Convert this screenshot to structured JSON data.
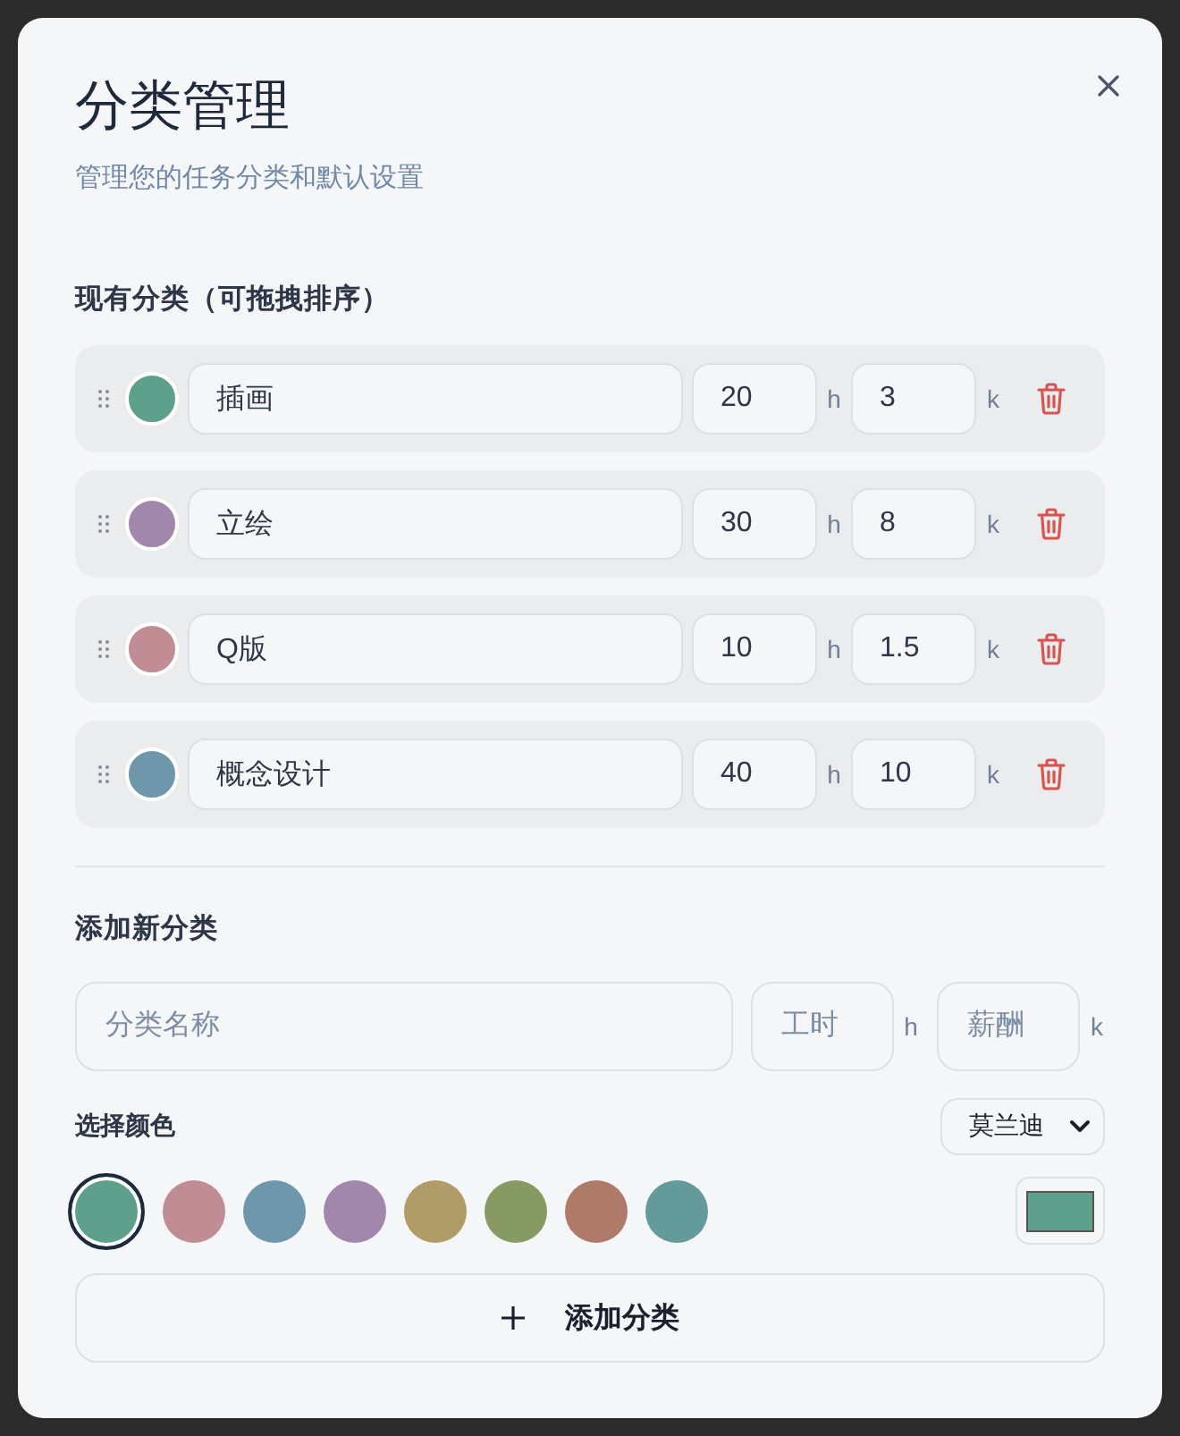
{
  "dialog": {
    "title": "分类管理",
    "subtitle": "管理您的任务分类和默认设置"
  },
  "existing": {
    "heading": "现有分类（可拖拽排序）",
    "categories": [
      {
        "name": "插画",
        "color": "#5fa08c",
        "hours": "20",
        "hours_unit": "h",
        "pay": "3",
        "pay_unit": "k"
      },
      {
        "name": "立绘",
        "color": "#a287ad",
        "hours": "30",
        "hours_unit": "h",
        "pay": "8",
        "pay_unit": "k"
      },
      {
        "name": "Q版",
        "color": "#bf8d93",
        "hours": "10",
        "hours_unit": "h",
        "pay": "1.5",
        "pay_unit": "k"
      },
      {
        "name": "概念设计",
        "color": "#6f97ab",
        "hours": "40",
        "hours_unit": "h",
        "pay": "10",
        "pay_unit": "k"
      }
    ]
  },
  "add_new": {
    "heading": "添加新分类",
    "name_field": {
      "placeholder": "分类名称"
    },
    "hours_field": {
      "placeholder": "工时",
      "unit": "h"
    },
    "pay_field": {
      "placeholder": "薪酬",
      "unit": "k"
    },
    "color_label": "选择颜色",
    "palette_select": {
      "value": "莫兰迪"
    },
    "swatches": [
      {
        "color": "#5fa08c",
        "selected": true
      },
      {
        "color": "#bf8d93",
        "selected": false
      },
      {
        "color": "#6f97ab",
        "selected": false
      },
      {
        "color": "#a287ad",
        "selected": false
      },
      {
        "color": "#b09c68",
        "selected": false
      },
      {
        "color": "#879a64",
        "selected": false
      },
      {
        "color": "#ae7a69",
        "selected": false
      },
      {
        "color": "#659a9b",
        "selected": false
      }
    ],
    "button": "添加分类"
  }
}
